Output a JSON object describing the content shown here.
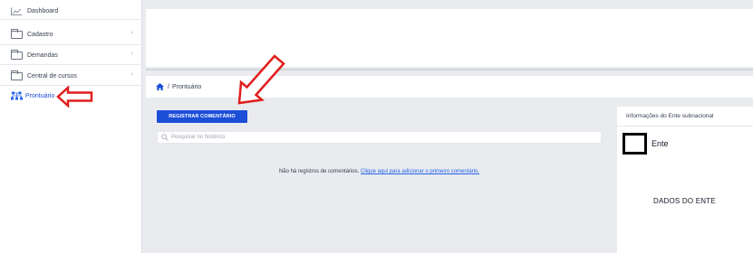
{
  "sidebar": {
    "items": [
      {
        "label": "Dashboard",
        "icon": "chart-line-icon"
      },
      {
        "label": "Cadastro",
        "icon": "folder-icon",
        "chevron": "‹"
      },
      {
        "label": "Demandas",
        "icon": "folder-icon",
        "chevron": "‹"
      },
      {
        "label": "Central de cursos",
        "icon": "folder-icon",
        "chevron": "‹"
      },
      {
        "label": "Prontuário",
        "icon": "sitemap-icon",
        "active": true
      }
    ]
  },
  "breadcrumb": {
    "separator": "/",
    "current": "Prontuário"
  },
  "toolbar": {
    "register_label": "REGISTRAR COMENTÁRIO"
  },
  "search": {
    "placeholder": "Pesquisar no histórico"
  },
  "empty_state": {
    "text": "Não há registros de comentários.",
    "link": "Clique aqui para adicionar o primeiro comentário."
  },
  "info_panel": {
    "title": "Informações do Ente subnacional",
    "ente_label": "Ente",
    "dados_label": "DADOS DO ENTE"
  },
  "colors": {
    "accent": "#1d4ed8",
    "annotation": "#e11d1d"
  }
}
